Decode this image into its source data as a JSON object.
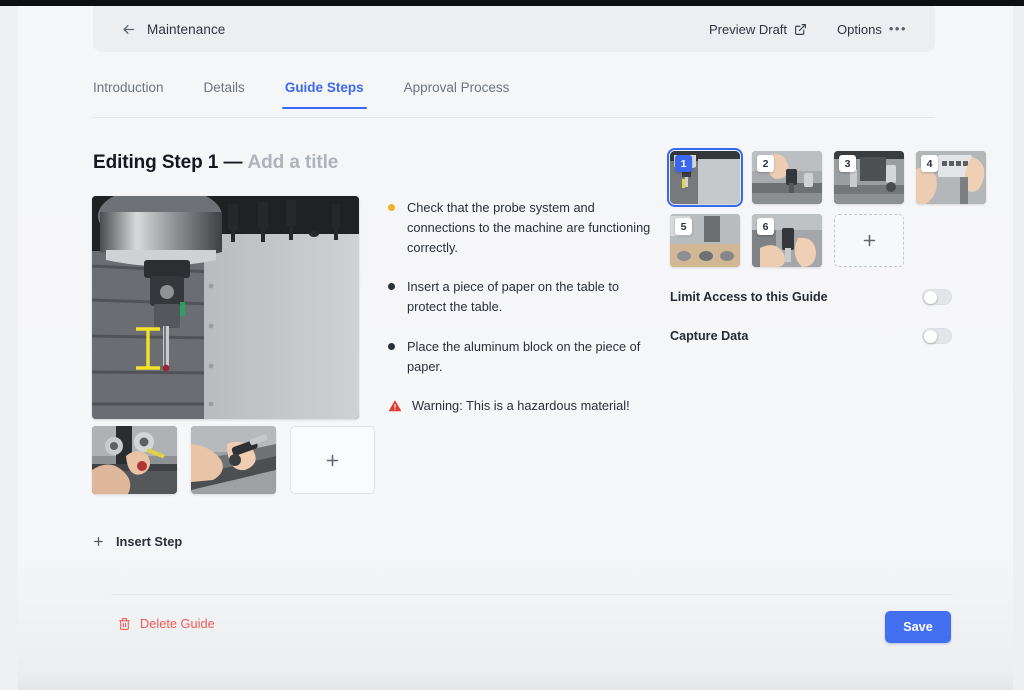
{
  "header": {
    "back_icon": "arrow-left-icon",
    "breadcrumb": "Maintenance",
    "preview_label": "Preview Draft",
    "preview_icon": "external-link-icon",
    "options_label": "Options",
    "options_icon": "ellipsis-icon"
  },
  "tabs": [
    {
      "label": "Introduction",
      "active": false
    },
    {
      "label": "Details",
      "active": false
    },
    {
      "label": "Guide Steps",
      "active": true
    },
    {
      "label": "Approval Process",
      "active": false
    }
  ],
  "editor": {
    "title_prefix": "Editing Step 1 — ",
    "title_placeholder": "Add a title",
    "hero_alt": "cnc-machine-spindle-probe",
    "media_strip": [
      {
        "alt": "hands-measuring-tool-1"
      },
      {
        "alt": "hands-assembling-tool-2"
      }
    ],
    "add_media_label": "+",
    "instructions": [
      {
        "bullet_color": "#f2b01e",
        "text": "Check that the probe system and connections to the machine are functioning correctly."
      },
      {
        "bullet_color": "#2b3038",
        "text": "Insert a piece of paper on the table to protect the table."
      },
      {
        "bullet_color": "#2b3038",
        "text": "Place the aluminum block on the piece of paper."
      }
    ],
    "warning": {
      "icon": "warning-triangle-icon",
      "color": "#e23b2e",
      "text": "Warning: This is a hazardous material!"
    },
    "insert_step": {
      "icon": "plus-icon",
      "label": "Insert Step"
    }
  },
  "steps_panel": {
    "steps": [
      {
        "number": "1",
        "selected": true,
        "alt": "step-1-machine-spindle"
      },
      {
        "number": "2",
        "selected": false,
        "alt": "step-2-hand-on-machine"
      },
      {
        "number": "3",
        "selected": false,
        "alt": "step-3-machine-table"
      },
      {
        "number": "4",
        "selected": false,
        "alt": "step-4-control-panel"
      },
      {
        "number": "5",
        "selected": false,
        "alt": "step-5-parts-on-bench"
      },
      {
        "number": "6",
        "selected": false,
        "alt": "step-6-hands-holding-probe"
      }
    ],
    "add_step_label": "+",
    "options": [
      {
        "label": "Limit Access to this Guide",
        "enabled": false
      },
      {
        "label": "Capture Data",
        "enabled": false
      }
    ]
  },
  "footer": {
    "delete_icon": "trash-icon",
    "delete_label": "Delete Guide",
    "save_label": "Save"
  },
  "colors": {
    "accent": "#3b68f0",
    "save": "#4370f1",
    "danger": "#ef5a53",
    "warning": "#e23b2e",
    "amber": "#f2b01e"
  }
}
